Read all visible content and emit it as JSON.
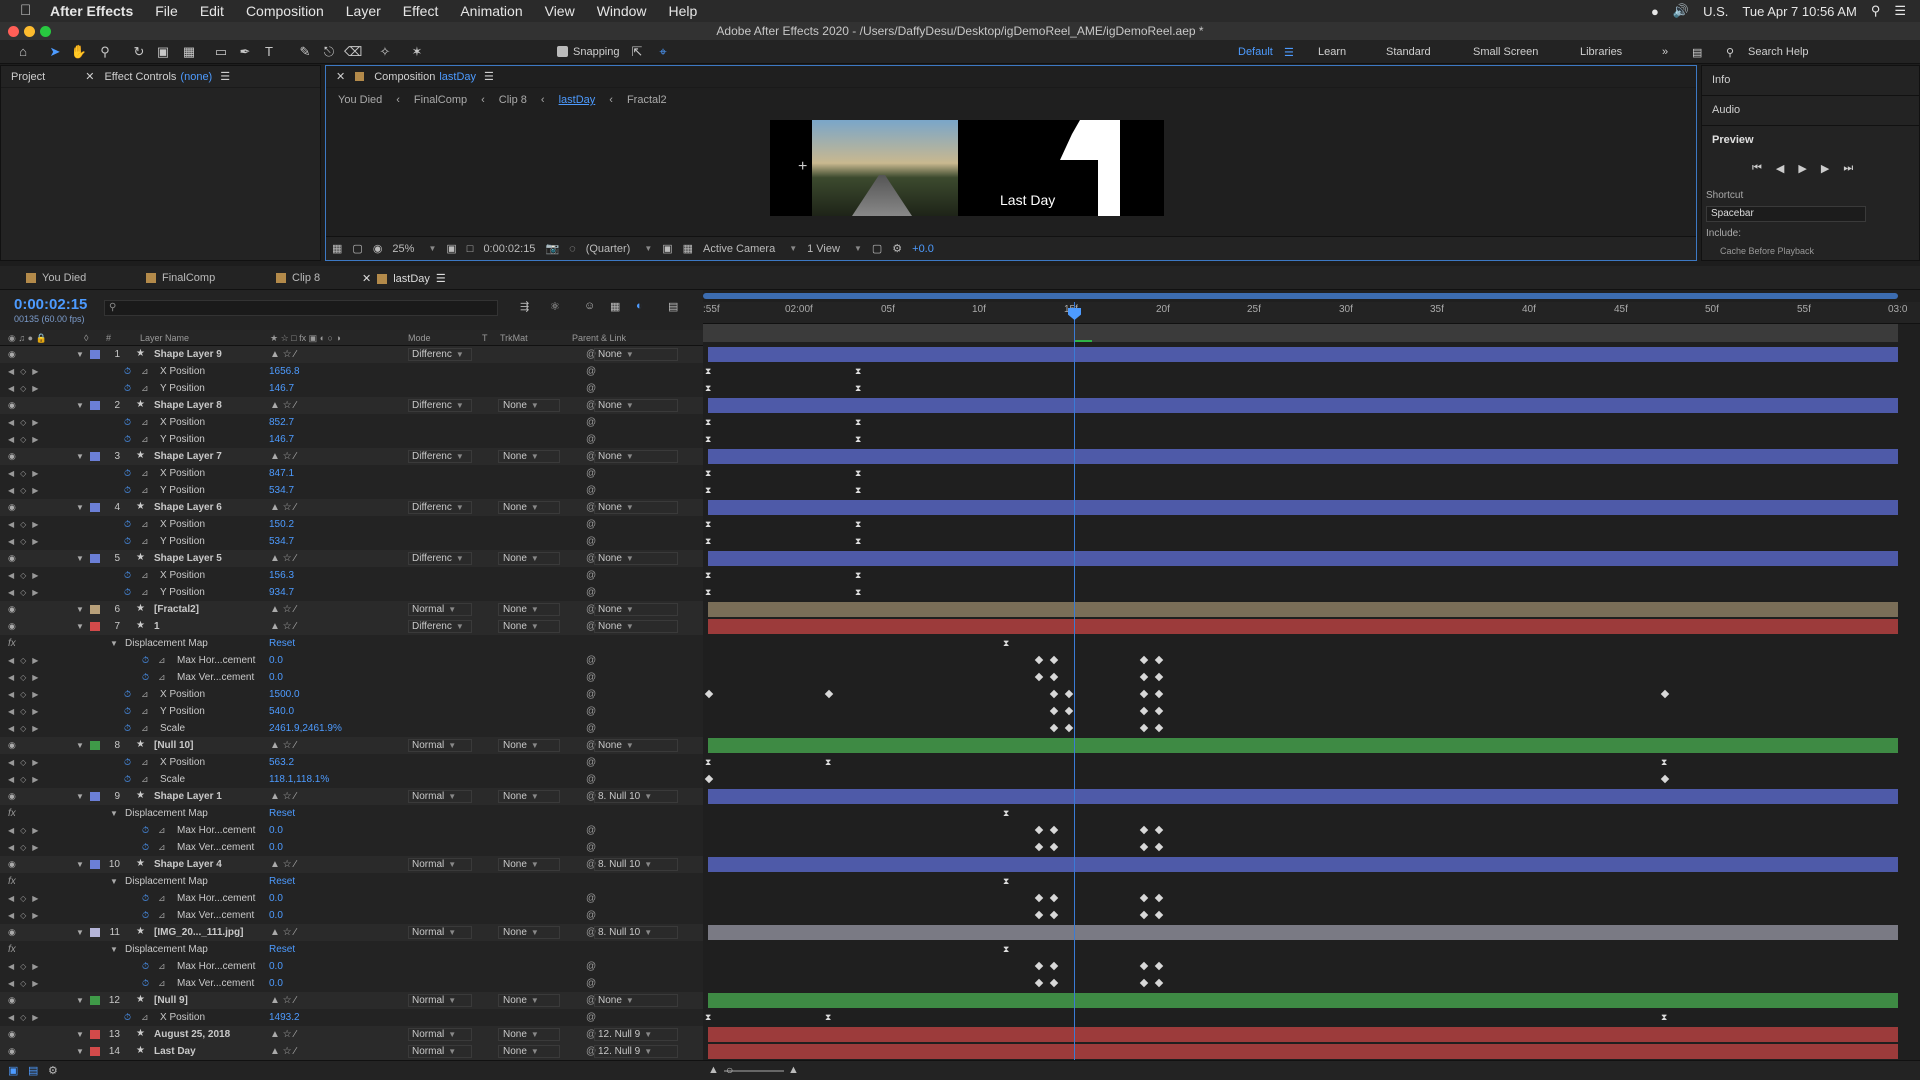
{
  "menubar": {
    "app": "After Effects",
    "items": [
      "File",
      "Edit",
      "Composition",
      "Layer",
      "Effect",
      "Animation",
      "View",
      "Window",
      "Help"
    ],
    "locale": "U.S.",
    "clock": "Tue Apr 7  10:56 AM"
  },
  "window_title": "Adobe After Effects 2020 - /Users/DaffyDesu/Desktop/igDemoReel_AME/igDemoReel.aep *",
  "toolbar": {
    "snapping": "Snapping",
    "workspaces": [
      "Default",
      "Learn",
      "Standard",
      "Small Screen",
      "Libraries"
    ],
    "search_placeholder": "Search Help"
  },
  "left_panel": {
    "project": "Project",
    "effect_controls": "Effect Controls",
    "effect_controls_target": "(none)"
  },
  "composition_panel": {
    "label": "Composition",
    "comp_name": "lastDay",
    "breadcrumbs": [
      "You Died",
      "FinalComp",
      "Clip 8",
      "lastDay",
      "Fractal2"
    ],
    "preview_text": "Last Day",
    "big_numeral": "1",
    "footer": {
      "zoom": "25%",
      "timecode": "0:00:02:15",
      "resolution": "(Quarter)",
      "camera": "Active Camera",
      "views": "1 View",
      "exposure": "+0.0"
    }
  },
  "right_panel": {
    "info": "Info",
    "audio": "Audio",
    "preview": "Preview",
    "shortcut_label": "Shortcut",
    "shortcut_value": "Spacebar",
    "include_label": "Include:",
    "cache_label": "Cache Before Playback"
  },
  "timeline_tabs": [
    "You Died",
    "FinalComp",
    "Clip 8",
    "lastDay"
  ],
  "timeline": {
    "timecode": "0:00:02:15",
    "frame_info": "00135 (60.00 fps)",
    "col_headers": {
      "layer_name": "Layer Name",
      "mode": "Mode",
      "t": "T",
      "trkmat": "TrkMat",
      "parent": "Parent & Link"
    },
    "ruler_ticks": [
      ":55f",
      "02:00f",
      "05f",
      "10f",
      "15f",
      "20f",
      "25f",
      "30f",
      "35f",
      "40f",
      "45f",
      "50f",
      "55f",
      "03:0"
    ]
  },
  "rows": [
    {
      "type": "layer",
      "num": "1",
      "name": "Shape Layer 9",
      "mode": "Differenc",
      "trk": "",
      "parent": "None",
      "color": "#6b7fd6",
      "bar": "#4e5aa8"
    },
    {
      "type": "prop",
      "name": "X Position",
      "value": "1656.8",
      "kf": [
        [
          0,
          "h"
        ],
        [
          150,
          "h"
        ]
      ]
    },
    {
      "type": "prop",
      "name": "Y Position",
      "value": "146.7",
      "kf": [
        [
          0,
          "h"
        ],
        [
          150,
          "h"
        ]
      ]
    },
    {
      "type": "layer",
      "num": "2",
      "name": "Shape Layer 8",
      "mode": "Differenc",
      "trk": "None",
      "parent": "None",
      "color": "#6b7fd6",
      "bar": "#4e5aa8"
    },
    {
      "type": "prop",
      "name": "X Position",
      "value": "852.7",
      "kf": [
        [
          0,
          "h"
        ],
        [
          150,
          "h"
        ]
      ]
    },
    {
      "type": "prop",
      "name": "Y Position",
      "value": "146.7",
      "kf": [
        [
          0,
          "h"
        ],
        [
          150,
          "h"
        ]
      ]
    },
    {
      "type": "layer",
      "num": "3",
      "name": "Shape Layer 7",
      "mode": "Differenc",
      "trk": "None",
      "parent": "None",
      "color": "#6b7fd6",
      "bar": "#4e5aa8"
    },
    {
      "type": "prop",
      "name": "X Position",
      "value": "847.1",
      "kf": [
        [
          0,
          "h"
        ],
        [
          150,
          "h"
        ]
      ]
    },
    {
      "type": "prop",
      "name": "Y Position",
      "value": "534.7",
      "kf": [
        [
          0,
          "h"
        ],
        [
          150,
          "h"
        ]
      ]
    },
    {
      "type": "layer",
      "num": "4",
      "name": "Shape Layer 6",
      "mode": "Differenc",
      "trk": "None",
      "parent": "None",
      "color": "#6b7fd6",
      "bar": "#4e5aa8"
    },
    {
      "type": "prop",
      "name": "X Position",
      "value": "150.2",
      "kf": [
        [
          0,
          "h"
        ],
        [
          150,
          "h"
        ]
      ]
    },
    {
      "type": "prop",
      "name": "Y Position",
      "value": "534.7",
      "kf": [
        [
          0,
          "h"
        ],
        [
          150,
          "h"
        ]
      ]
    },
    {
      "type": "layer",
      "num": "5",
      "name": "Shape Layer 5",
      "mode": "Differenc",
      "trk": "None",
      "parent": "None",
      "color": "#6b7fd6",
      "bar": "#4e5aa8"
    },
    {
      "type": "prop",
      "name": "X Position",
      "value": "156.3",
      "kf": [
        [
          0,
          "h"
        ],
        [
          150,
          "h"
        ]
      ]
    },
    {
      "type": "prop",
      "name": "Y Position",
      "value": "934.7",
      "kf": [
        [
          0,
          "h"
        ],
        [
          150,
          "h"
        ]
      ]
    },
    {
      "type": "layer",
      "num": "6",
      "name": "[Fractal2]",
      "mode": "Normal",
      "trk": "None",
      "parent": "None",
      "color": "#b8a07a",
      "bar": "#7a6e58"
    },
    {
      "type": "layer",
      "num": "7",
      "name": "1",
      "mode": "Differenc",
      "trk": "None",
      "parent": "None",
      "color": "#d24a4a",
      "bar": "#9c3b3b"
    },
    {
      "type": "effect",
      "name": "Displacement Map",
      "reset": "Reset",
      "kf": [
        [
          298,
          "h"
        ]
      ]
    },
    {
      "type": "prop2",
      "name": "Max Hor...cement",
      "value": "0.0",
      "kf": [
        [
          330,
          "d"
        ],
        [
          345,
          "d"
        ],
        [
          435,
          "d"
        ],
        [
          450,
          "d"
        ]
      ]
    },
    {
      "type": "prop2",
      "name": "Max Ver...cement",
      "value": "0.0",
      "kf": [
        [
          330,
          "d"
        ],
        [
          345,
          "d"
        ],
        [
          435,
          "d"
        ],
        [
          450,
          "d"
        ]
      ]
    },
    {
      "type": "prop",
      "name": "X Position",
      "value": "1500.0",
      "kf": [
        [
          0,
          "d"
        ],
        [
          120,
          "d"
        ],
        [
          345,
          "d"
        ],
        [
          360,
          "d"
        ],
        [
          435,
          "d"
        ],
        [
          450,
          "d"
        ],
        [
          956,
          "d"
        ]
      ]
    },
    {
      "type": "prop",
      "name": "Y Position",
      "value": "540.0",
      "kf": [
        [
          345,
          "d"
        ],
        [
          360,
          "d"
        ],
        [
          435,
          "d"
        ],
        [
          450,
          "d"
        ]
      ]
    },
    {
      "type": "prop",
      "name": "Scale",
      "value": "2461.9,2461.9%",
      "kf": [
        [
          345,
          "d"
        ],
        [
          360,
          "d"
        ],
        [
          435,
          "d"
        ],
        [
          450,
          "d"
        ]
      ]
    },
    {
      "type": "layer",
      "num": "8",
      "name": "[Null 10]",
      "mode": "Normal",
      "trk": "None",
      "parent": "None",
      "color": "#3f9a48",
      "bar": "#3e8a44"
    },
    {
      "type": "prop",
      "name": "X Position",
      "value": "563.2",
      "kf": [
        [
          0,
          "h"
        ],
        [
          120,
          "h"
        ],
        [
          956,
          "h"
        ]
      ]
    },
    {
      "type": "prop",
      "name": "Scale",
      "value": "118.1,118.1%",
      "kf": [
        [
          0,
          "d"
        ],
        [
          956,
          "d"
        ]
      ]
    },
    {
      "type": "layer",
      "num": "9",
      "name": "Shape Layer 1",
      "mode": "Normal",
      "trk": "None",
      "parent": "8. Null 10",
      "color": "#6b7fd6",
      "bar": "#4e5aa8"
    },
    {
      "type": "effect",
      "name": "Displacement Map",
      "reset": "Reset",
      "kf": [
        [
          298,
          "h"
        ]
      ]
    },
    {
      "type": "prop2",
      "name": "Max Hor...cement",
      "value": "0.0",
      "kf": [
        [
          330,
          "d"
        ],
        [
          345,
          "d"
        ],
        [
          435,
          "d"
        ],
        [
          450,
          "d"
        ]
      ]
    },
    {
      "type": "prop2",
      "name": "Max Ver...cement",
      "value": "0.0",
      "kf": [
        [
          330,
          "d"
        ],
        [
          345,
          "d"
        ],
        [
          435,
          "d"
        ],
        [
          450,
          "d"
        ]
      ]
    },
    {
      "type": "layer",
      "num": "10",
      "name": "Shape Layer 4",
      "mode": "Normal",
      "trk": "None",
      "parent": "8. Null 10",
      "color": "#6b7fd6",
      "bar": "#4e5aa8"
    },
    {
      "type": "effect",
      "name": "Displacement Map",
      "reset": "Reset",
      "kf": [
        [
          298,
          "h"
        ]
      ]
    },
    {
      "type": "prop2",
      "name": "Max Hor...cement",
      "value": "0.0",
      "kf": [
        [
          330,
          "d"
        ],
        [
          345,
          "d"
        ],
        [
          435,
          "d"
        ],
        [
          450,
          "d"
        ]
      ]
    },
    {
      "type": "prop2",
      "name": "Max Ver...cement",
      "value": "0.0",
      "kf": [
        [
          330,
          "d"
        ],
        [
          345,
          "d"
        ],
        [
          435,
          "d"
        ],
        [
          450,
          "d"
        ]
      ]
    },
    {
      "type": "layer",
      "num": "11",
      "name": "[IMG_20..._111.jpg]",
      "mode": "Normal",
      "trk": "None",
      "parent": "8. Null 10",
      "color": "#b5b5d8",
      "bar": "#7a7a84"
    },
    {
      "type": "effect",
      "name": "Displacement Map",
      "reset": "Reset",
      "kf": [
        [
          298,
          "h"
        ]
      ]
    },
    {
      "type": "prop2",
      "name": "Max Hor...cement",
      "value": "0.0",
      "kf": [
        [
          330,
          "d"
        ],
        [
          345,
          "d"
        ],
        [
          435,
          "d"
        ],
        [
          450,
          "d"
        ]
      ]
    },
    {
      "type": "prop2",
      "name": "Max Ver...cement",
      "value": "0.0",
      "kf": [
        [
          330,
          "d"
        ],
        [
          345,
          "d"
        ],
        [
          435,
          "d"
        ],
        [
          450,
          "d"
        ]
      ]
    },
    {
      "type": "layer",
      "num": "12",
      "name": "[Null 9]",
      "mode": "Normal",
      "trk": "None",
      "parent": "None",
      "color": "#3f9a48",
      "bar": "#3e8a44"
    },
    {
      "type": "prop",
      "name": "X Position",
      "value": "1493.2",
      "kf": [
        [
          0,
          "h"
        ],
        [
          120,
          "h"
        ],
        [
          956,
          "h"
        ]
      ]
    },
    {
      "type": "layer",
      "num": "13",
      "name": "August 25, 2018",
      "mode": "Normal",
      "trk": "None",
      "parent": "12. Null 9",
      "color": "#d24a4a",
      "bar": "#9c3b3b"
    },
    {
      "type": "layer",
      "num": "14",
      "name": "Last Day",
      "mode": "Normal",
      "trk": "None",
      "parent": "12. Null 9",
      "color": "#d24a4a",
      "bar": "#9c3b3b"
    }
  ]
}
